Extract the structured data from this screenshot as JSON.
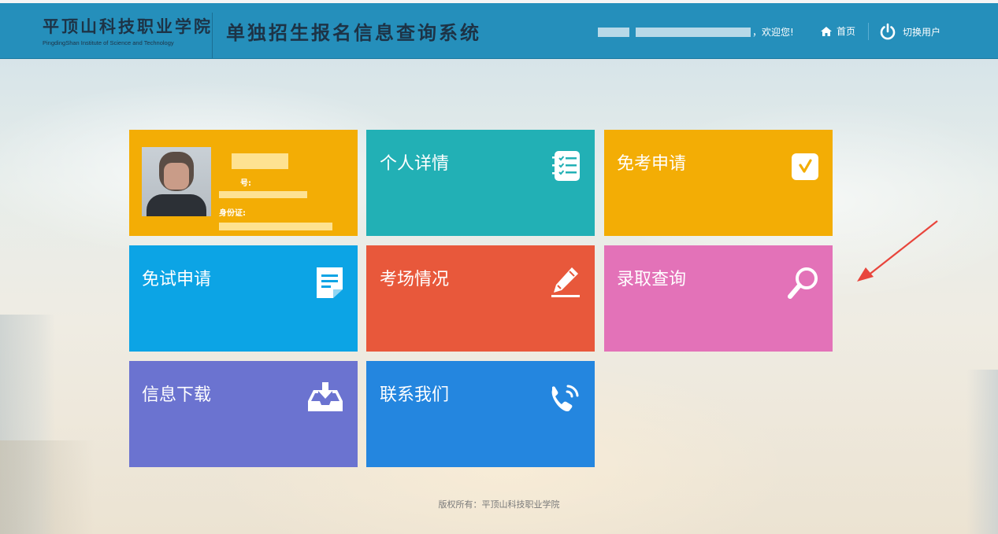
{
  "header": {
    "school_name_cn": "平顶山科技职业学院",
    "school_name_en": "PingdingShan Institute of Science and Technology",
    "system_title": "单独招生报名信息查询系统",
    "welcome": "，欢迎您!",
    "home_label": "首页",
    "switch_user_label": "切换用户",
    "icons": {
      "home": "home-icon",
      "switch": "power-icon"
    }
  },
  "profile": {
    "number_label": "号:",
    "id_label": "身份证:"
  },
  "tiles": [
    {
      "label": "个人详情",
      "color": "#22b0b5",
      "icon": "checklist-icon"
    },
    {
      "label": "免考申请",
      "color": "#f3ad05",
      "icon": "checkbox-icon"
    },
    {
      "label": "免试申请",
      "color": "#0ca4e5",
      "icon": "document-icon"
    },
    {
      "label": "考场情况",
      "color": "#e8583b",
      "icon": "pencil-icon"
    },
    {
      "label": "录取查询",
      "color": "#e372b8",
      "icon": "search-icon"
    },
    {
      "label": "信息下载",
      "color": "#6b73d0",
      "icon": "download-icon"
    },
    {
      "label": "联系我们",
      "color": "#2486df",
      "icon": "phone-icon"
    }
  ],
  "colors": {
    "header_bg": "#258fbb",
    "profile_tile": "#f3ad05",
    "arrow": "#e8453c"
  },
  "footer": "版权所有：平顶山科技职业学院"
}
